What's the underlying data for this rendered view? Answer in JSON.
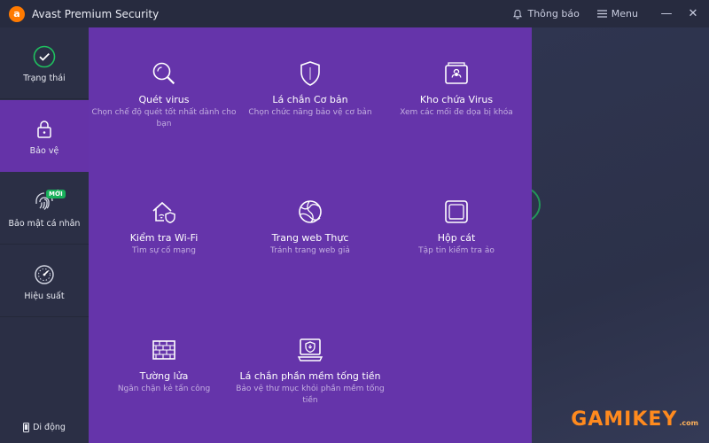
{
  "app": {
    "logo_letter": "a",
    "title": "Avast Premium Security"
  },
  "titlebar": {
    "notifications": "Thông báo",
    "menu": "Menu",
    "minimize": "—",
    "close": "✕"
  },
  "sidebar": {
    "items": [
      {
        "label": "Trạng thái",
        "icon": "check-circle-icon"
      },
      {
        "label": "Bảo vệ",
        "icon": "lock-icon"
      },
      {
        "label": "Bảo mật cá nhân",
        "icon": "fingerprint-icon",
        "badge": "MỚI"
      },
      {
        "label": "Hiệu suất",
        "icon": "speedometer-icon"
      }
    ],
    "mobile": "Di động"
  },
  "tiles": [
    {
      "title": "Quét virus",
      "desc": "Chọn chế độ quét tốt nhất dành cho bạn",
      "icon": "magnifier-icon"
    },
    {
      "title": "Lá chắn Cơ bản",
      "desc": "Chọn chức năng bảo vệ cơ bản",
      "icon": "shield-icon"
    },
    {
      "title": "Kho chứa Virus",
      "desc": "Xem các mối đe dọa bị khóa",
      "icon": "biohazard-chest-icon"
    },
    {
      "title": "Kiểm tra Wi-Fi",
      "desc": "Tìm sự cố mạng",
      "icon": "home-wifi-shield-icon"
    },
    {
      "title": "Trang web Thực",
      "desc": "Tránh trang web giả",
      "icon": "globe-icon"
    },
    {
      "title": "Hộp cát",
      "desc": "Tập tin kiểm tra ảo",
      "icon": "sandbox-icon"
    },
    {
      "title": "Tường lửa",
      "desc": "Ngăn chặn kẻ tấn công",
      "icon": "firewall-icon"
    },
    {
      "title": "Lá chắn phần mềm tống tiền",
      "desc": "Bảo vệ thư mục khỏi phần mềm tống tiền",
      "icon": "ransomware-shield-icon"
    }
  ],
  "watermark": {
    "text": "GAMIKEY",
    "suffix": ".com"
  }
}
